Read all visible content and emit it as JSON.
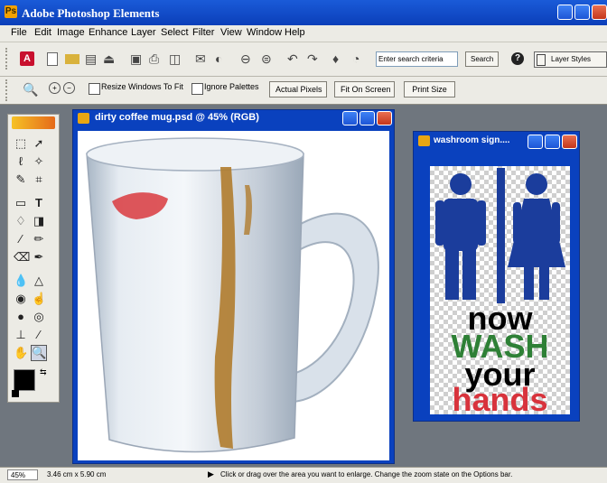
{
  "app": {
    "title": "Adobe Photoshop Elements"
  },
  "menu": [
    "File",
    "Edit",
    "Image",
    "Enhance",
    "Layer",
    "Select",
    "Filter",
    "View",
    "Window",
    "Help"
  ],
  "shortcuts": {
    "search_placeholder": "Enter search criteria",
    "search_button": "Search",
    "layer_styles": "Layer Styles"
  },
  "options": {
    "resize_windows": "Resize Windows To Fit",
    "ignore_palettes": "Ignore Palettes",
    "actual_pixels": "Actual Pixels",
    "fit_on_screen": "Fit On Screen",
    "print_size": "Print Size"
  },
  "documents": {
    "mug": {
      "title": "dirty coffee mug.psd @ 45% (RGB)"
    },
    "sign": {
      "title": "washroom sign....",
      "lines": [
        "now",
        "WASH",
        "your",
        "hands"
      ]
    }
  },
  "colors": {
    "titlebar": "#0b3fb9",
    "sign_blue": "#1b3d9c",
    "sign_green": "#2e8036",
    "sign_red": "#d8333c"
  },
  "status": {
    "zoom": "45%",
    "size": "3.46 cm x 5.90 cm",
    "hint": "Click or drag over the area you want to enlarge. Change the zoom state on the Options bar."
  }
}
